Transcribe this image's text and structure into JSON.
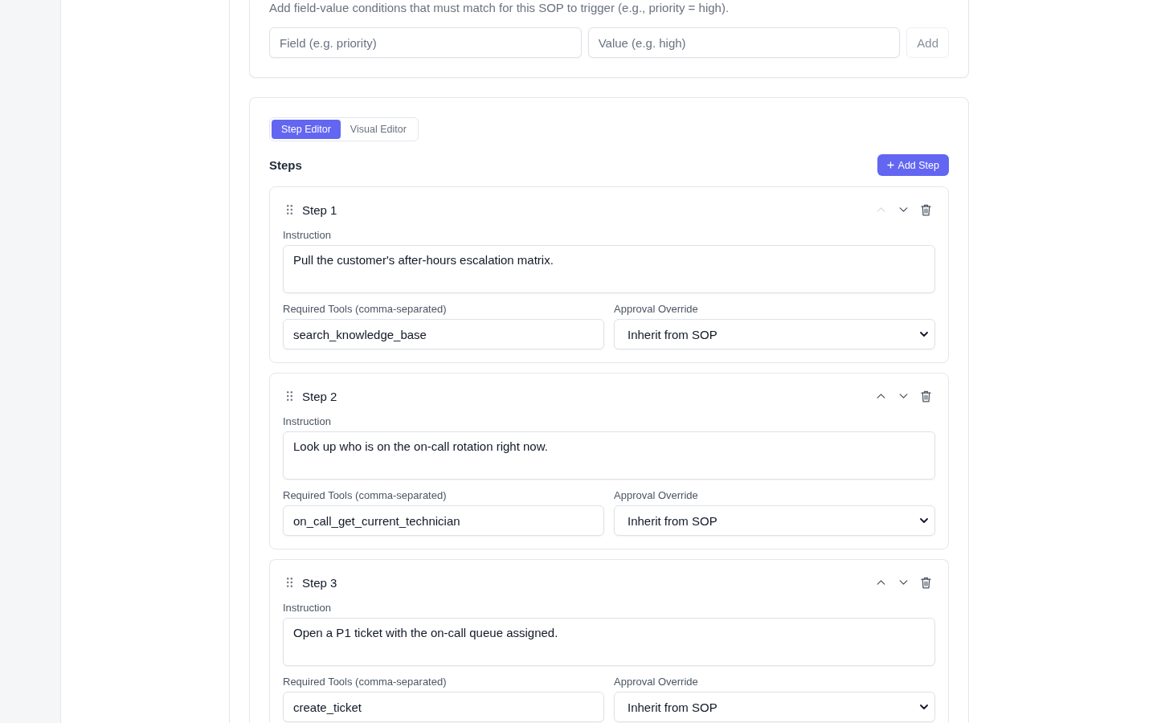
{
  "conditions": {
    "description": "Add field-value conditions that must match for this SOP to trigger (e.g., priority = high).",
    "field_input": {
      "placeholder": "Field (e.g. priority)"
    },
    "value_input": {
      "placeholder": "Value (e.g. high)"
    },
    "add_button": "Add"
  },
  "editor": {
    "tabs": [
      {
        "label": "Step Editor",
        "selected": true
      },
      {
        "label": "Visual Editor",
        "selected": false
      }
    ],
    "steps_title": "Steps",
    "add_step_button": "Add Step",
    "steps": [
      {
        "title": "Step 1",
        "move_up_disabled": true,
        "instruction_label": "Instruction",
        "instruction": "Pull the customer's after-hours escalation matrix.",
        "tools_label": "Required Tools (comma-separated)",
        "tools": "search_knowledge_base",
        "approval_label": "Approval Override",
        "approval": "Inherit from SOP"
      },
      {
        "title": "Step 2",
        "move_up_disabled": false,
        "instruction_label": "Instruction",
        "instruction": "Look up who is on the on-call rotation right now.",
        "tools_label": "Required Tools (comma-separated)",
        "tools": "on_call_get_current_technician",
        "approval_label": "Approval Override",
        "approval": "Inherit from SOP"
      },
      {
        "title": "Step 3",
        "move_up_disabled": false,
        "instruction_label": "Instruction",
        "instruction": "Open a P1 ticket with the on-call queue assigned.",
        "tools_label": "Required Tools (comma-separated)",
        "tools": "create_ticket",
        "approval_label": "Approval Override",
        "approval": "Inherit from SOP"
      }
    ]
  }
}
